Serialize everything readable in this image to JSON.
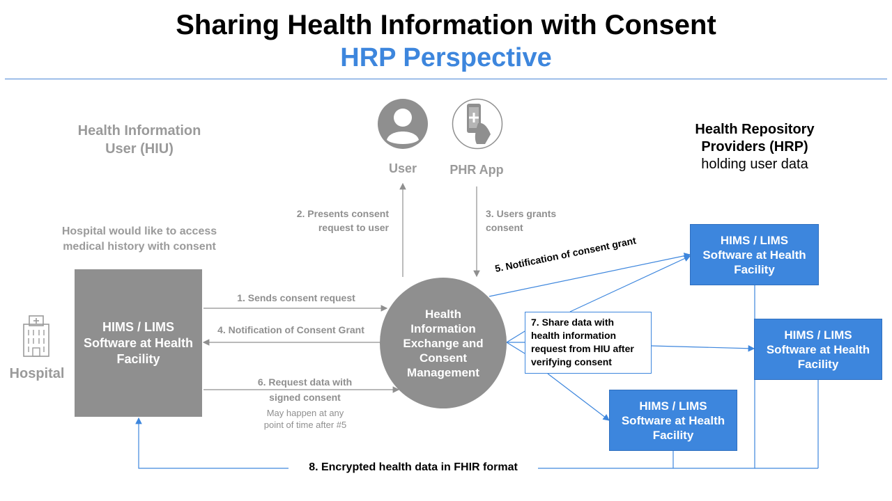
{
  "header": {
    "title": "Sharing Health Information with Consent",
    "subtitle": "HRP Perspective"
  },
  "hiu": {
    "heading": "Health Information User (HIU)",
    "description_line1": "Hospital would like to access",
    "description_line2": "medical history with consent",
    "box_label": "HIMS / LIMS Software at Health Facility",
    "hospital_label": "Hospital"
  },
  "actors": {
    "user_label": "User",
    "phr_label": "PHR App"
  },
  "hrp": {
    "heading": "Health Repository Providers (HRP)",
    "subheading": "holding user data",
    "box_label": "HIMS / LIMS Software at Health Facility"
  },
  "center": {
    "label": "Health Information Exchange and Consent Management"
  },
  "steps": {
    "s1": "1. Sends consent request",
    "s2_line1": "2. Presents consent",
    "s2_line2": "request to user",
    "s3_line1": "3. Users grants",
    "s3_line2": "consent",
    "s4": "4. Notification of Consent Grant",
    "s5": "5. Notification of consent grant",
    "s6_line1": "6. Request data with",
    "s6_line2": "signed consent",
    "s6_note_line1": "May happen at any",
    "s6_note_line2": "point of time after #5",
    "s7": "7. Share data with health information request from HIU after verifying consent",
    "s8": "8. Encrypted health data in FHIR format"
  },
  "colors": {
    "blue": "#3d86dd",
    "gray": "#8f8f8f"
  }
}
